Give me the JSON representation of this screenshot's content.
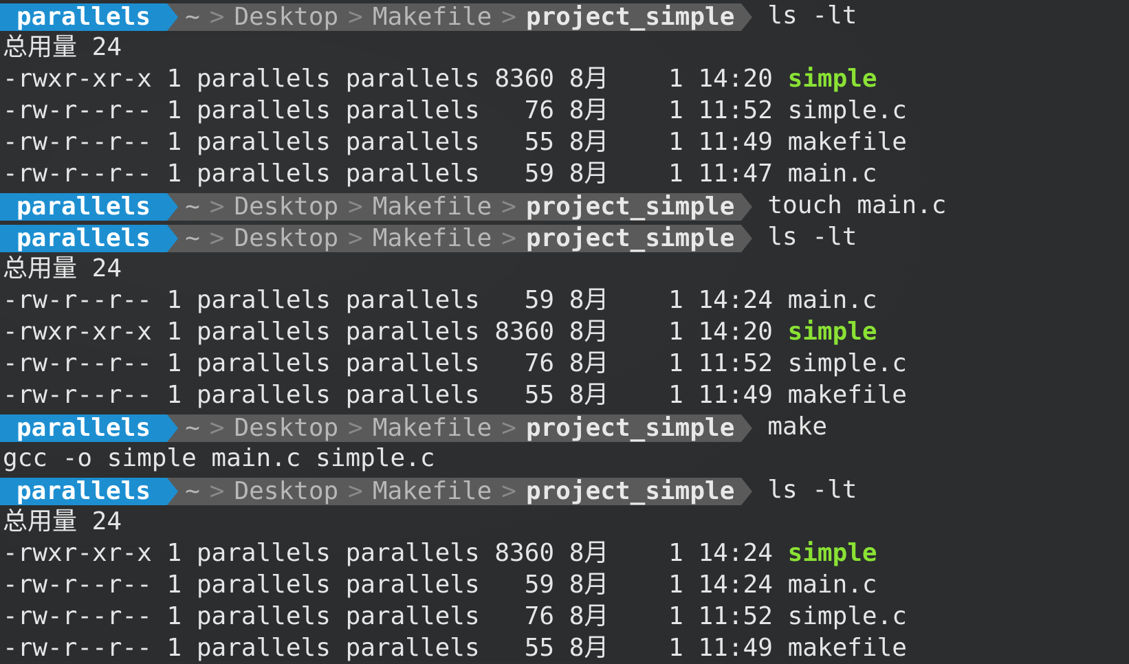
{
  "prompt": {
    "user": "parallels",
    "path": [
      "~",
      "Desktop",
      "Makefile"
    ],
    "cwd": "project_simple",
    "separator": ">"
  },
  "colors": {
    "user_bg": "#1d8fd1",
    "path_bg": "#5a5a5a",
    "executable": "#8ae234",
    "terminal_bg": "#2b2d2f"
  },
  "blocks": [
    {
      "command": "ls -lt",
      "output": [
        {
          "text": "总用量 24"
        },
        {
          "perm": "-rwxr-xr-x",
          "links": "1",
          "owner": "parallels",
          "group": "parallels",
          "size": "8360",
          "month": "8月",
          "day": "1",
          "time": "14:20",
          "name": "simple",
          "exec": true
        },
        {
          "perm": "-rw-r--r--",
          "links": "1",
          "owner": "parallels",
          "group": "parallels",
          "size": "76",
          "month": "8月",
          "day": "1",
          "time": "11:52",
          "name": "simple.c",
          "exec": false
        },
        {
          "perm": "-rw-r--r--",
          "links": "1",
          "owner": "parallels",
          "group": "parallels",
          "size": "55",
          "month": "8月",
          "day": "1",
          "time": "11:49",
          "name": "makefile",
          "exec": false
        },
        {
          "perm": "-rw-r--r--",
          "links": "1",
          "owner": "parallels",
          "group": "parallels",
          "size": "59",
          "month": "8月",
          "day": "1",
          "time": "11:47",
          "name": "main.c",
          "exec": false
        }
      ]
    },
    {
      "command": "touch main.c",
      "output": []
    },
    {
      "command": "ls -lt",
      "output": [
        {
          "text": "总用量 24"
        },
        {
          "perm": "-rw-r--r--",
          "links": "1",
          "owner": "parallels",
          "group": "parallels",
          "size": "59",
          "month": "8月",
          "day": "1",
          "time": "14:24",
          "name": "main.c",
          "exec": false
        },
        {
          "perm": "-rwxr-xr-x",
          "links": "1",
          "owner": "parallels",
          "group": "parallels",
          "size": "8360",
          "month": "8月",
          "day": "1",
          "time": "14:20",
          "name": "simple",
          "exec": true
        },
        {
          "perm": "-rw-r--r--",
          "links": "1",
          "owner": "parallels",
          "group": "parallels",
          "size": "76",
          "month": "8月",
          "day": "1",
          "time": "11:52",
          "name": "simple.c",
          "exec": false
        },
        {
          "perm": "-rw-r--r--",
          "links": "1",
          "owner": "parallels",
          "group": "parallels",
          "size": "55",
          "month": "8月",
          "day": "1",
          "time": "11:49",
          "name": "makefile",
          "exec": false
        }
      ]
    },
    {
      "command": "make",
      "output": [
        {
          "text": "gcc -o simple main.c simple.c"
        }
      ]
    },
    {
      "command": "ls -lt",
      "output": [
        {
          "text": "总用量 24"
        },
        {
          "perm": "-rwxr-xr-x",
          "links": "1",
          "owner": "parallels",
          "group": "parallels",
          "size": "8360",
          "month": "8月",
          "day": "1",
          "time": "14:24",
          "name": "simple",
          "exec": true
        },
        {
          "perm": "-rw-r--r--",
          "links": "1",
          "owner": "parallels",
          "group": "parallels",
          "size": "59",
          "month": "8月",
          "day": "1",
          "time": "14:24",
          "name": "main.c",
          "exec": false
        },
        {
          "perm": "-rw-r--r--",
          "links": "1",
          "owner": "parallels",
          "group": "parallels",
          "size": "76",
          "month": "8月",
          "day": "1",
          "time": "11:52",
          "name": "simple.c",
          "exec": false
        },
        {
          "perm": "-rw-r--r--",
          "links": "1",
          "owner": "parallels",
          "group": "parallels",
          "size": "55",
          "month": "8月",
          "day": "1",
          "time": "11:49",
          "name": "makefile",
          "exec": false
        }
      ]
    }
  ]
}
